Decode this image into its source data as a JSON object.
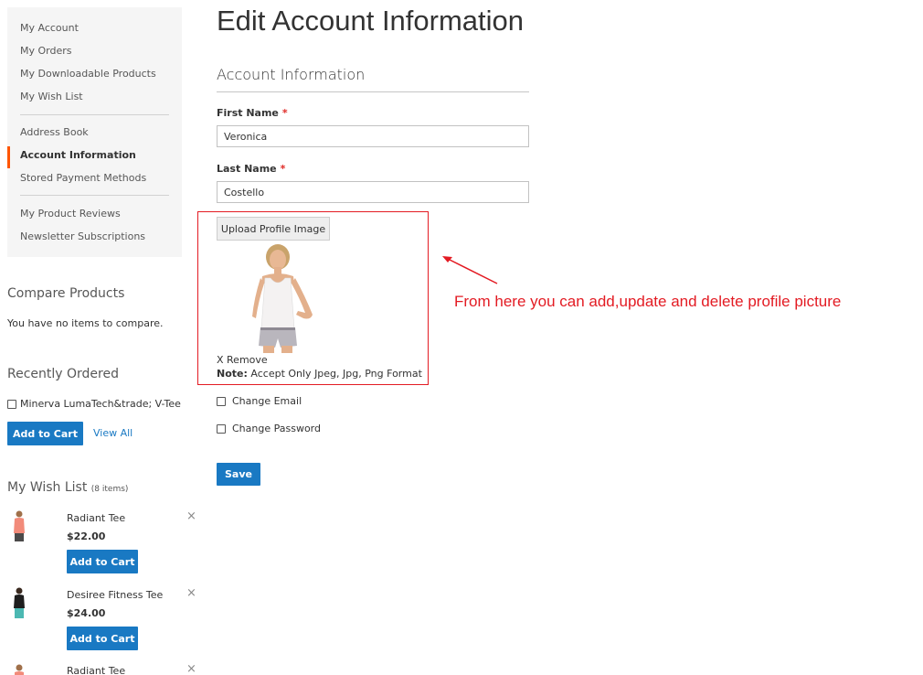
{
  "sidebar": {
    "nav": [
      {
        "label": "My Account"
      },
      {
        "label": "My Orders"
      },
      {
        "label": "My Downloadable Products"
      },
      {
        "label": "My Wish List"
      },
      {
        "label": "Address Book"
      },
      {
        "label": "Account Information",
        "active": true
      },
      {
        "label": "Stored Payment Methods"
      },
      {
        "label": "My Product Reviews"
      },
      {
        "label": "Newsletter Subscriptions"
      }
    ],
    "compare": {
      "title": "Compare Products",
      "empty_text": "You have no items to compare."
    },
    "recently_ordered": {
      "title": "Recently Ordered",
      "item": "Minerva LumaTech&trade; V-Tee",
      "add_to_cart": "Add to Cart",
      "view_all": "View All"
    },
    "wishlist": {
      "title": "My Wish List",
      "count": "(8 items)",
      "items": [
        {
          "name": "Radiant Tee",
          "price": "$22.00",
          "button": "Add to Cart",
          "remove": "×"
        },
        {
          "name": "Desiree Fitness Tee",
          "price": "$24.00",
          "button": "Add to Cart",
          "remove": "×"
        },
        {
          "name": "Radiant Tee",
          "remove": "×"
        }
      ]
    }
  },
  "main": {
    "title": "Edit Account Information",
    "section_title": "Account Information",
    "first_name": {
      "label": "First Name",
      "required": "*",
      "value": "Veronica"
    },
    "last_name": {
      "label": "Last Name",
      "required": "*",
      "value": "Costello"
    },
    "upload_button": "Upload Profile Image",
    "remove_link": "X Remove",
    "note_label": "Note:",
    "note_text": " Accept Only Jpeg, Jpg, Png Format",
    "change_email": "Change Email",
    "change_password": "Change Password",
    "save": "Save"
  },
  "annotation": {
    "text": "From here you can add,update and delete profile picture",
    "color": "#e31b23"
  },
  "colors": {
    "accent": "#1979c3",
    "active_nav_bar": "#ff5501"
  }
}
